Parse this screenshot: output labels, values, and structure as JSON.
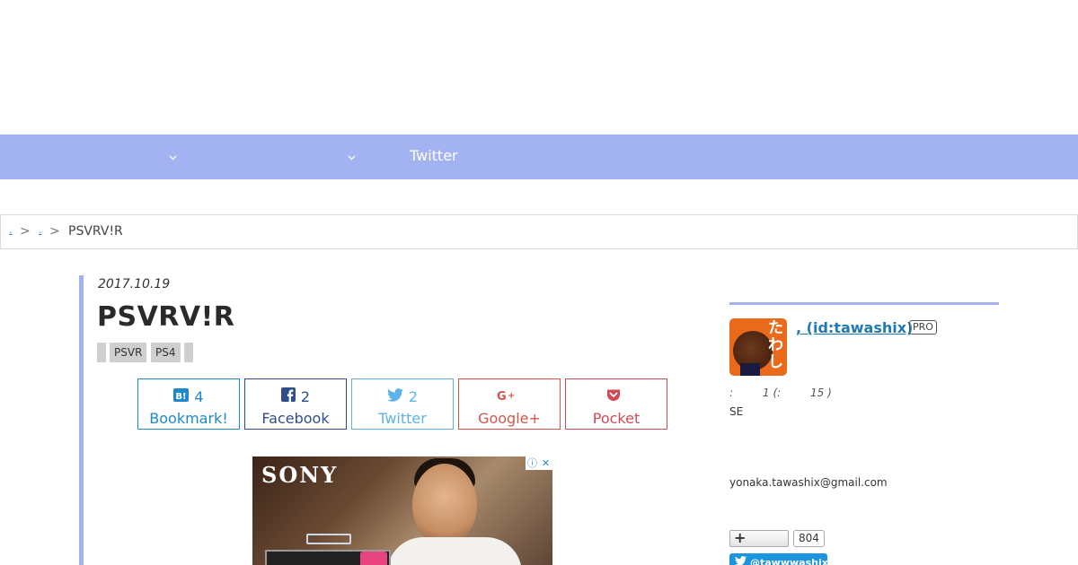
{
  "nav": {
    "twitter_label": "Twitter"
  },
  "breadcrumb": {
    "link1": ".",
    "link2": ".",
    "separator": ">",
    "current": "PSVRV!R"
  },
  "article": {
    "date": "2017.10.19",
    "title": "PSVRV!R",
    "tags": [
      "",
      "PSVR",
      "PS4",
      ""
    ]
  },
  "share": {
    "hatena": {
      "count": "4",
      "label": "Bookmark!",
      "icon": "hatena-bookmark-icon"
    },
    "facebook": {
      "count": "2",
      "label": "Facebook",
      "icon": "facebook-icon"
    },
    "twitter": {
      "count": "2",
      "label": "Twitter",
      "icon": "twitter-bird-icon"
    },
    "googleplus": {
      "count": "",
      "label": "Google+",
      "icon": "google-plus-icon"
    },
    "pocket": {
      "count": "",
      "label": "Pocket",
      "icon": "pocket-icon"
    }
  },
  "ad": {
    "brand": "SONY",
    "info_glyph": "ⓘ",
    "close_glyph": "✕"
  },
  "sidebar": {
    "user_link": ", (id:tawashix)",
    "pro_badge": "PRO",
    "avatar_text": "たわし",
    "stats_colon": ":",
    "stats_one": "1 (:",
    "stats_fifteen": "15 )",
    "se_text": "SE",
    "email": "yonaka.tawashix@gmail.com",
    "follow_plus": "+",
    "follow_count": "804",
    "twitter_follow": "@tawwwashix"
  },
  "colors": {
    "accent": "#a3b2f0",
    "link": "#1f7ab3"
  }
}
